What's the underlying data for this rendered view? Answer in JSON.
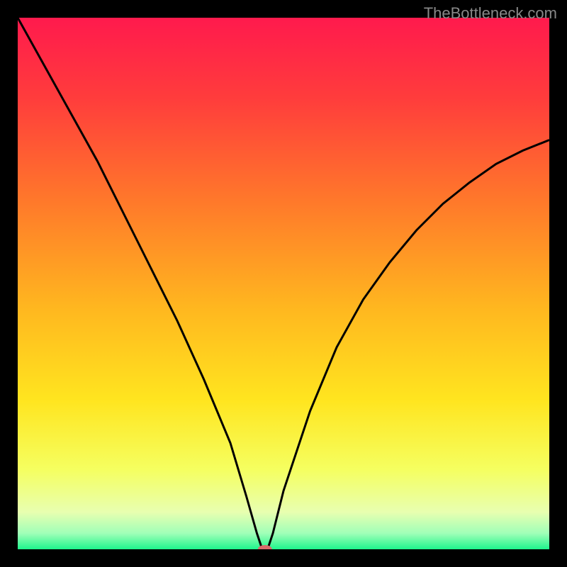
{
  "watermark": "TheBottleneck.com",
  "chart_data": {
    "type": "line",
    "title": "",
    "xlabel": "",
    "ylabel": "",
    "xlim": [
      0,
      100
    ],
    "ylim": [
      0,
      100
    ],
    "gradient_stops": [
      {
        "offset": 0,
        "color": "#ff1a4d"
      },
      {
        "offset": 15,
        "color": "#ff3c3c"
      },
      {
        "offset": 35,
        "color": "#ff7a2a"
      },
      {
        "offset": 55,
        "color": "#ffb81f"
      },
      {
        "offset": 72,
        "color": "#ffe51f"
      },
      {
        "offset": 85,
        "color": "#f5ff60"
      },
      {
        "offset": 93,
        "color": "#e8ffb0"
      },
      {
        "offset": 97,
        "color": "#a0ffb8"
      },
      {
        "offset": 100,
        "color": "#1ef58c"
      }
    ],
    "series": [
      {
        "name": "bottleneck-curve",
        "x": [
          0,
          5,
          10,
          15,
          20,
          25,
          30,
          35,
          40,
          43,
          45,
          46,
          47,
          48,
          50,
          55,
          60,
          65,
          70,
          75,
          80,
          85,
          90,
          95,
          100
        ],
        "y": [
          100,
          91,
          82,
          73,
          63,
          53,
          43,
          32,
          20,
          10,
          3,
          0,
          0,
          3,
          11,
          26,
          38,
          47,
          54,
          60,
          65,
          69,
          72.5,
          75,
          77
        ]
      }
    ],
    "marker": {
      "x": 46.5,
      "y": 0,
      "color": "#d96a6a"
    }
  }
}
